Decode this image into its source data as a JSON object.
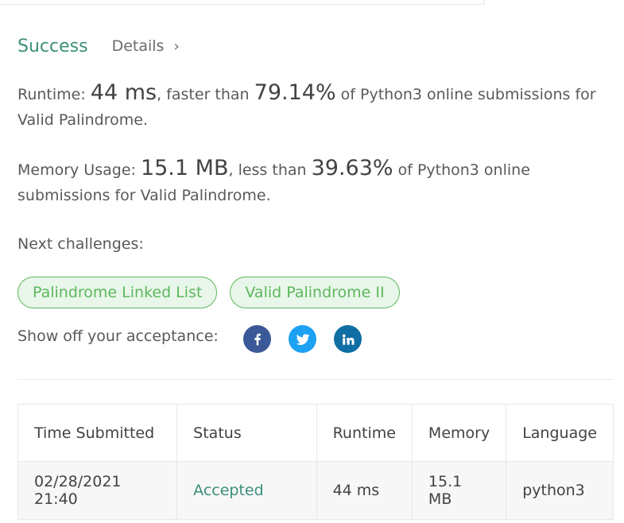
{
  "result": {
    "status": "Success",
    "details_label": "Details",
    "runtime": {
      "label": "Runtime: ",
      "value": "44 ms",
      "mid": ", faster than ",
      "percent": "79.14%",
      "suffix": " of Python3 online submissions for Valid Palindrome."
    },
    "memory": {
      "label": "Memory Usage: ",
      "value": "15.1 MB",
      "mid": ", less than ",
      "percent": "39.63%",
      "suffix": " of Python3 online submissions for Valid Palindrome."
    }
  },
  "next": {
    "label": "Next challenges:",
    "challenges": [
      "Palindrome Linked List",
      "Valid Palindrome II"
    ]
  },
  "share": {
    "label": "Show off your acceptance:",
    "networks": [
      "facebook-icon",
      "twitter-icon",
      "linkedin-icon"
    ]
  },
  "table": {
    "headers": [
      "Time Submitted",
      "Status",
      "Runtime",
      "Memory",
      "Language"
    ],
    "rows": [
      [
        "02/28/2021 21:40",
        "Accepted",
        "44 ms",
        "15.1 MB",
        "python3"
      ]
    ]
  },
  "colors": {
    "success": "#3c8f7a",
    "chip_border": "#5cb85c",
    "facebook": "#3b5998",
    "twitter": "#1da1f2",
    "linkedin": "#0f6ea3"
  }
}
